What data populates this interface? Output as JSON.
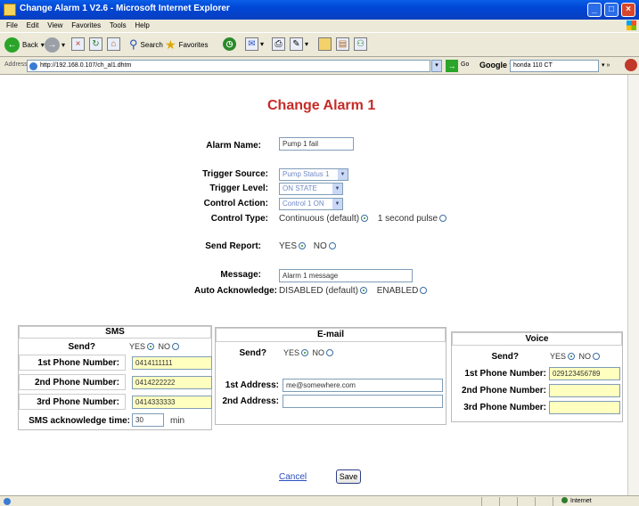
{
  "window": {
    "title": "Change Alarm 1 V2.6 - Microsoft Internet Explorer"
  },
  "menu": [
    "File",
    "Edit",
    "View",
    "Favorites",
    "Tools",
    "Help"
  ],
  "toolbar": {
    "back": "Back",
    "search": "Search",
    "favorites": "Favorites"
  },
  "address": {
    "label": "Address",
    "url": "http://192.168.0.107/ch_al1.dhtm",
    "go": "Go"
  },
  "google": {
    "label": "Google",
    "query": "honda 110 CT"
  },
  "page": {
    "title": "Change Alarm 1"
  },
  "form": {
    "alarm_name": {
      "label": "Alarm Name:",
      "value": "Pump 1 fail"
    },
    "trigger_source": {
      "label": "Trigger Source:",
      "value": "Pump Status 1"
    },
    "trigger_level": {
      "label": "Trigger Level:",
      "value": "ON STATE"
    },
    "control_action": {
      "label": "Control Action:",
      "value": "Control 1 ON"
    },
    "control_type": {
      "label": "Control Type:",
      "opt1": "Continuous (default)",
      "opt2": "1 second pulse"
    },
    "send_report": {
      "label": "Send Report:",
      "yes": "YES",
      "no": "NO"
    },
    "message": {
      "label": "Message:",
      "value": "Alarm 1 message"
    },
    "auto_ack": {
      "label": "Auto Acknowledge:",
      "opt1": "DISABLED (default)",
      "opt2": "ENABLED"
    }
  },
  "sms": {
    "header": "SMS",
    "send_label": "Send?",
    "yes": "YES",
    "no": "NO",
    "phone1_label": "1st Phone Number:",
    "phone1": "0414111111",
    "phone2_label": "2nd Phone Number:",
    "phone2": "0414222222",
    "phone3_label": "3rd Phone Number:",
    "phone3": "0414333333",
    "ack_label": "SMS acknowledge time:",
    "ack_value": "30",
    "ack_unit": "min"
  },
  "email": {
    "header": "E-mail",
    "send_label": "Send?",
    "yes": "YES",
    "no": "NO",
    "addr1_label": "1st Address:",
    "addr1": "me@somewhere.com",
    "addr2_label": "2nd Address:",
    "addr2": ""
  },
  "voice": {
    "header": "Voice",
    "send_label": "Send?",
    "yes": "YES",
    "no": "NO",
    "phone1_label": "1st Phone Number:",
    "phone1": "029123456789",
    "phone2_label": "2nd Phone Number:",
    "phone2": "",
    "phone3_label": "3rd Phone Number:",
    "phone3": ""
  },
  "actions": {
    "cancel": "Cancel",
    "save": "Save"
  },
  "status": {
    "zone": "Internet"
  }
}
